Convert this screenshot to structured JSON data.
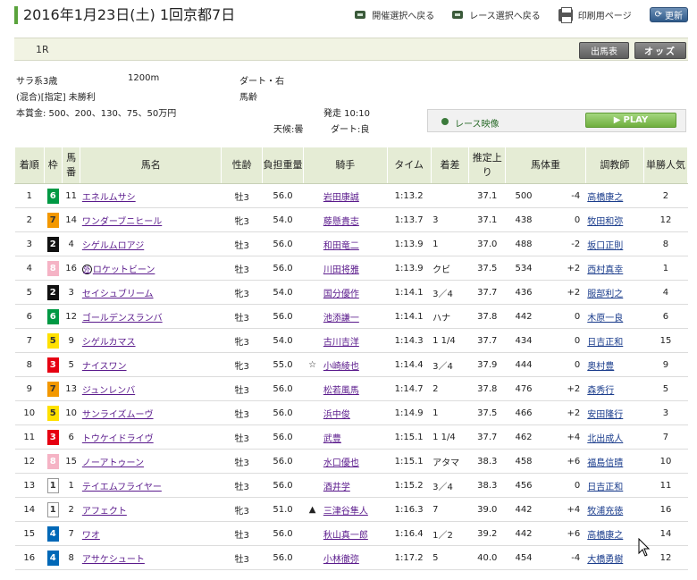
{
  "header": {
    "title": "2016年1月23日(土) 1回京都7日",
    "links": {
      "meeting": "開催選択へ戻る",
      "race": "レース選択へ戻る",
      "print": "印刷用ページ",
      "refresh": "更新"
    }
  },
  "race": {
    "number": "1R",
    "shutuba_label": "出馬表",
    "odds_label": "オッズ",
    "class": "サラ系3歳",
    "distance": "1200m",
    "course": "ダート・右",
    "conditions": "(混合)[指定] 未勝利",
    "weight_rule": "馬齢",
    "prize": "本賞金:  500、200、130、75、50万円",
    "start_time": "発走 10:10",
    "weather": "天候:曇",
    "track": "ダート:良",
    "video_label": "レース映像",
    "play_label": "PLAY"
  },
  "table": {
    "headers": {
      "rank": "着順",
      "waku": "枠",
      "num": "馬番",
      "horse": "馬名",
      "sexage": "性齢",
      "weight": "負担重量",
      "jockey": "騎手",
      "time": "タイム",
      "margin": "着差",
      "last3f": "推定上り",
      "bodyweight": "馬体重",
      "trainer": "調教師",
      "pop": "単勝人気"
    },
    "rows": [
      {
        "rank": "1",
        "waku": "6",
        "num": "11",
        "horse": "エネルムサシ",
        "mark": "",
        "sexage": "牡3",
        "weight": "56.0",
        "jmark": "",
        "jockey": "岩田康誠",
        "time": "1:13.2",
        "margin": "",
        "last3f": "37.1",
        "bw": "500",
        "diff": "-4",
        "trainer": "高橋康之",
        "pop": "2"
      },
      {
        "rank": "2",
        "waku": "7",
        "num": "14",
        "horse": "ワンダーブニヒール",
        "mark": "",
        "sexage": "牝3",
        "weight": "54.0",
        "jmark": "",
        "jockey": "藤懸貴志",
        "time": "1:13.7",
        "margin": "3",
        "last3f": "37.1",
        "bw": "438",
        "diff": "0",
        "trainer": "牧田和弥",
        "pop": "12"
      },
      {
        "rank": "3",
        "waku": "2",
        "num": "4",
        "horse": "シゲルムロアジ",
        "mark": "",
        "sexage": "牡3",
        "weight": "56.0",
        "jmark": "",
        "jockey": "和田竜二",
        "time": "1:13.9",
        "margin": "1",
        "last3f": "37.0",
        "bw": "488",
        "diff": "-2",
        "trainer": "坂口正則",
        "pop": "8"
      },
      {
        "rank": "4",
        "waku": "8",
        "num": "16",
        "horse": "ロケットビーン",
        "mark": "外",
        "sexage": "牡3",
        "weight": "56.0",
        "jmark": "",
        "jockey": "川田将雅",
        "time": "1:13.9",
        "margin": "クビ",
        "last3f": "37.5",
        "bw": "534",
        "diff": "+2",
        "trainer": "西村真幸",
        "pop": "1"
      },
      {
        "rank": "5",
        "waku": "2",
        "num": "3",
        "horse": "セイシュブリーム",
        "mark": "",
        "sexage": "牝3",
        "weight": "54.0",
        "jmark": "",
        "jockey": "国分優作",
        "time": "1:14.1",
        "margin": "3／4",
        "last3f": "37.7",
        "bw": "436",
        "diff": "+2",
        "trainer": "服部利之",
        "pop": "4"
      },
      {
        "rank": "6",
        "waku": "6",
        "num": "12",
        "horse": "ゴールデンスランバ",
        "mark": "",
        "sexage": "牡3",
        "weight": "56.0",
        "jmark": "",
        "jockey": "池添謙一",
        "time": "1:14.1",
        "margin": "ハナ",
        "last3f": "37.8",
        "bw": "442",
        "diff": "0",
        "trainer": "木原一良",
        "pop": "6"
      },
      {
        "rank": "7",
        "waku": "5",
        "num": "9",
        "horse": "シゲルカマス",
        "mark": "",
        "sexage": "牝3",
        "weight": "54.0",
        "jmark": "",
        "jockey": "古川吉洋",
        "time": "1:14.3",
        "margin": "1 1/4",
        "last3f": "37.7",
        "bw": "434",
        "diff": "0",
        "trainer": "日吉正和",
        "pop": "15"
      },
      {
        "rank": "8",
        "waku": "3",
        "num": "5",
        "horse": "ナイスワン",
        "mark": "",
        "sexage": "牝3",
        "weight": "55.0",
        "jmark": "☆",
        "jockey": "小崎綾也",
        "time": "1:14.4",
        "margin": "3／4",
        "last3f": "37.9",
        "bw": "444",
        "diff": "0",
        "trainer": "奥村豊",
        "pop": "9"
      },
      {
        "rank": "9",
        "waku": "7",
        "num": "13",
        "horse": "ジュンレンバ",
        "mark": "",
        "sexage": "牡3",
        "weight": "56.0",
        "jmark": "",
        "jockey": "松若風馬",
        "time": "1:14.7",
        "margin": "2",
        "last3f": "37.8",
        "bw": "476",
        "diff": "+2",
        "trainer": "森秀行",
        "pop": "5"
      },
      {
        "rank": "10",
        "waku": "5",
        "num": "10",
        "horse": "サンライズムーヴ",
        "mark": "",
        "sexage": "牡3",
        "weight": "56.0",
        "jmark": "",
        "jockey": "浜中俊",
        "time": "1:14.9",
        "margin": "1",
        "last3f": "37.5",
        "bw": "466",
        "diff": "+2",
        "trainer": "安田隆行",
        "pop": "3"
      },
      {
        "rank": "11",
        "waku": "3",
        "num": "6",
        "horse": "トウケイドライヴ",
        "mark": "",
        "sexage": "牡3",
        "weight": "56.0",
        "jmark": "",
        "jockey": "武豊",
        "time": "1:15.1",
        "margin": "1 1/4",
        "last3f": "37.7",
        "bw": "462",
        "diff": "+4",
        "trainer": "北出成人",
        "pop": "7"
      },
      {
        "rank": "12",
        "waku": "8",
        "num": "15",
        "horse": "ノーアトゥーン",
        "mark": "",
        "sexage": "牡3",
        "weight": "56.0",
        "jmark": "",
        "jockey": "水口優也",
        "time": "1:15.1",
        "margin": "アタマ",
        "last3f": "38.3",
        "bw": "458",
        "diff": "+6",
        "trainer": "福島信晴",
        "pop": "10"
      },
      {
        "rank": "13",
        "waku": "1",
        "num": "1",
        "horse": "テイエムフライヤー",
        "mark": "",
        "sexage": "牡3",
        "weight": "56.0",
        "jmark": "",
        "jockey": "酒井学",
        "time": "1:15.2",
        "margin": "3／4",
        "last3f": "38.3",
        "bw": "456",
        "diff": "0",
        "trainer": "日吉正和",
        "pop": "11"
      },
      {
        "rank": "14",
        "waku": "1",
        "num": "2",
        "horse": "アフェクト",
        "mark": "",
        "sexage": "牝3",
        "weight": "51.0",
        "jmark": "▲",
        "jockey": "三津谷隼人",
        "time": "1:16.3",
        "margin": "7",
        "last3f": "39.0",
        "bw": "442",
        "diff": "+4",
        "trainer": "牧浦充徳",
        "pop": "16"
      },
      {
        "rank": "15",
        "waku": "4",
        "num": "7",
        "horse": "ワオ",
        "mark": "",
        "sexage": "牡3",
        "weight": "56.0",
        "jmark": "",
        "jockey": "秋山真一郎",
        "time": "1:16.4",
        "margin": "1／2",
        "last3f": "39.2",
        "bw": "442",
        "diff": "+6",
        "trainer": "高橋康之",
        "pop": "14"
      },
      {
        "rank": "16",
        "waku": "4",
        "num": "8",
        "horse": "アサケシュート",
        "mark": "",
        "sexage": "牡3",
        "weight": "56.0",
        "jmark": "",
        "jockey": "小林徹弥",
        "time": "1:17.2",
        "margin": "5",
        "last3f": "40.0",
        "bw": "454",
        "diff": "-4",
        "trainer": "大橋勇樹",
        "pop": "12"
      }
    ]
  }
}
